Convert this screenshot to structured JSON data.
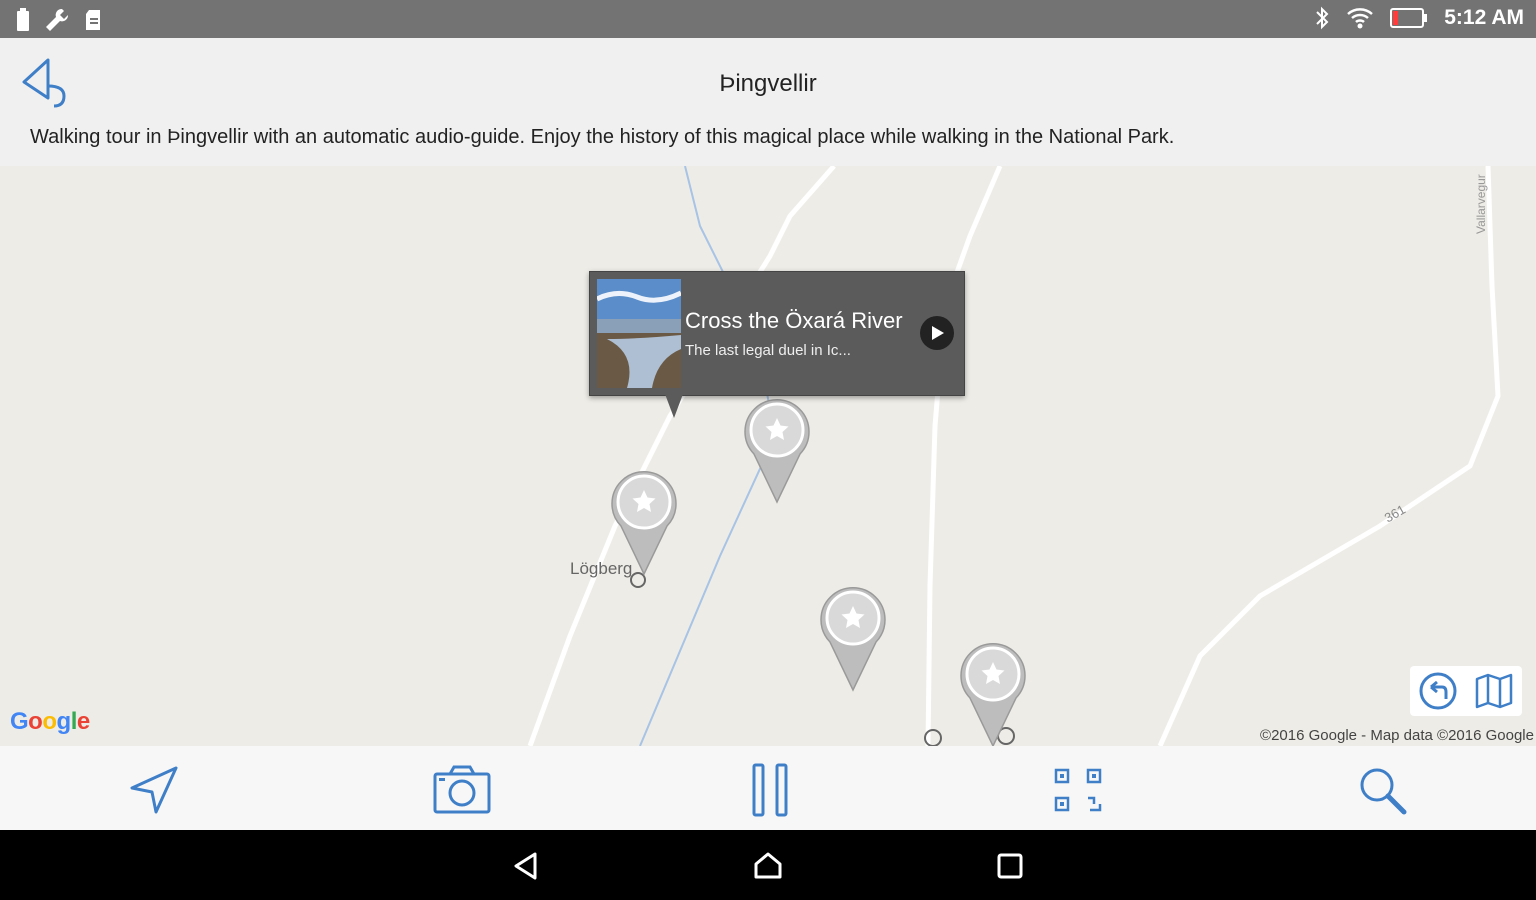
{
  "status_bar": {
    "time": "5:12 AM",
    "left_icons": [
      "battery-saver-icon",
      "wrench-icon",
      "sd-card-icon"
    ],
    "right_icons": [
      "bluetooth-icon",
      "wifi-icon",
      "battery-icon"
    ]
  },
  "header": {
    "title": "Þingvellir",
    "description": "Walking tour in Þingvellir with an automatic audio-guide. Enjoy the history of this magical place while walking in the National Park.",
    "back_icon": "back-arrow-icon"
  },
  "map": {
    "labels": {
      "logberg": "Lögberg",
      "yall": "Vallarvegur",
      "road": "361"
    },
    "google_logo": "Google",
    "copyright": "©2016 Google - Map data ©2016 Google",
    "controls": [
      "undo-location-icon",
      "map-layers-icon"
    ],
    "pins": [
      "star-pin",
      "star-pin",
      "star-pin",
      "star-pin"
    ],
    "callout": {
      "title": "Cross the Öxará River",
      "subtitle": "The last legal duel in Ic...",
      "play_icon": "play-icon"
    },
    "colors": {
      "land": "#eeece6",
      "road": "#ffffff",
      "river": "#a7c3e6",
      "pin": "#bdbdbd"
    }
  },
  "toolbar": {
    "items": [
      "navigation-arrow-icon",
      "camera-icon",
      "pause-icon",
      "qr-code-icon",
      "search-icon"
    ],
    "accent": "#3f7fc8"
  },
  "nav_bar": {
    "items": [
      "back-triangle-icon",
      "home-icon",
      "recents-square-icon"
    ]
  }
}
